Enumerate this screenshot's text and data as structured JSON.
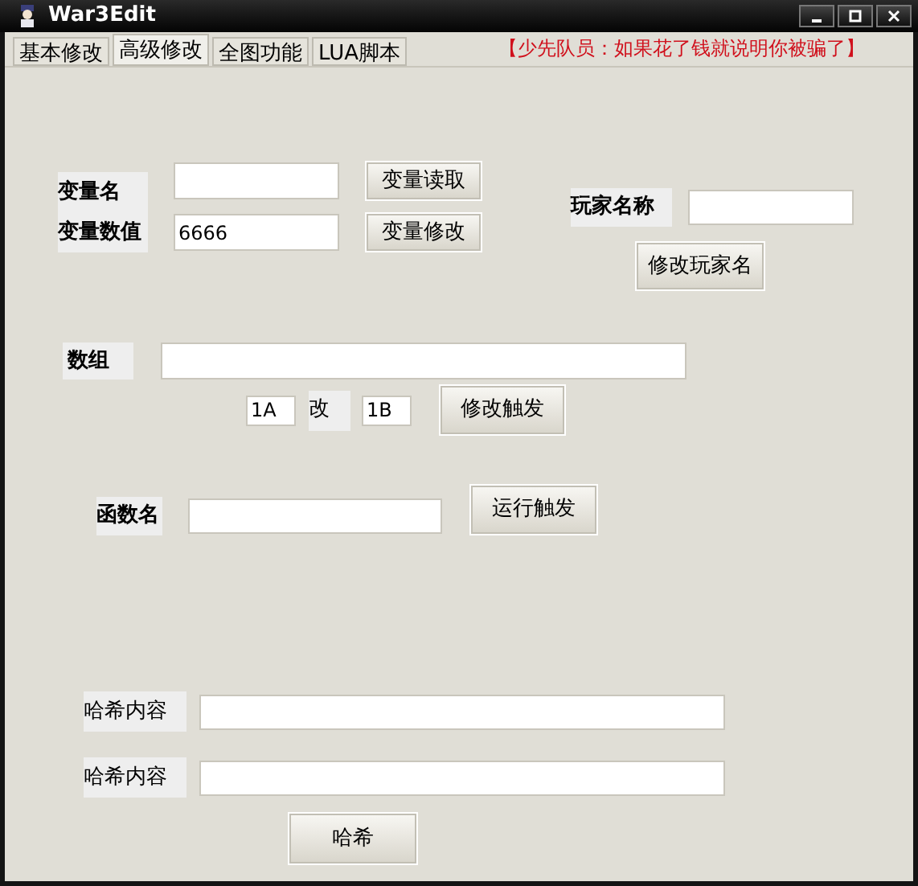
{
  "window": {
    "title": "War3Edit"
  },
  "tabs": [
    {
      "label": "基本修改",
      "selected": false
    },
    {
      "label": "高级修改",
      "selected": true
    },
    {
      "label": "全图功能",
      "selected": false
    },
    {
      "label": "LUA脚本",
      "selected": false
    }
  ],
  "notice": "【少先队员：如果花了钱就说明你被骗了】",
  "variable": {
    "name_label": "变量名",
    "value_label": "变量数值",
    "value": "6666",
    "read_button": "变量读取",
    "modify_button": "变量修改"
  },
  "player": {
    "label": "玩家名称",
    "button": "修改玩家名"
  },
  "array": {
    "label": "数组",
    "from_value": "1A",
    "to_label": "改",
    "to_value": "1B",
    "button": "修改触发"
  },
  "function": {
    "label": "函数名",
    "button": "运行触发"
  },
  "hash": {
    "fields": [
      {
        "label": "哈希内容"
      },
      {
        "label": "哈希内容"
      }
    ],
    "button": "哈希"
  }
}
